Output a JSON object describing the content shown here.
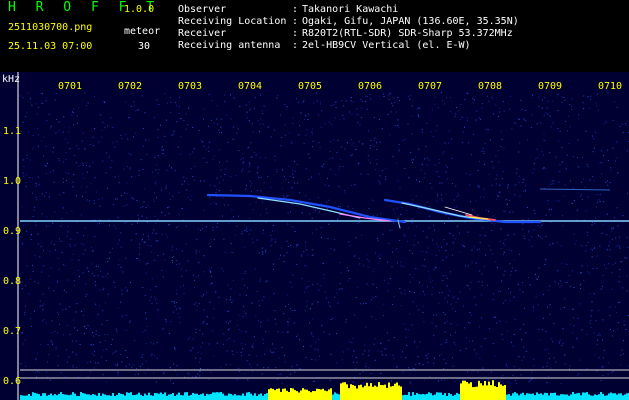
{
  "header": {
    "app_title": "H R O F F T",
    "version": "1.0.0",
    "filename": "2511030700.png",
    "category": "meteor",
    "datetime": "25.11.03 07:00",
    "count": "30"
  },
  "info": [
    {
      "label": "Observer",
      "value": "Takanori Kawachi"
    },
    {
      "label": "Receiving Location",
      "value": "Ogaki, Gifu, JAPAN (136.60E, 35.35N)"
    },
    {
      "label": "Receiver",
      "value": "R820T2(RTL-SDR) SDR-Sharp 53.372MHz"
    },
    {
      "label": "Receiving antenna",
      "value": "2el-HB9CV Vertical (el. E-W)"
    }
  ],
  "separator": ":",
  "axis": {
    "unit_label": "kHz",
    "x_ticks": [
      "0701",
      "0702",
      "0703",
      "0704",
      "0705",
      "0706",
      "0707",
      "0708",
      "0709",
      "0710"
    ],
    "y_ticks": [
      "1.1",
      "1.0",
      "0.9",
      "0.8",
      "0.7",
      "0.6"
    ]
  },
  "colors": {
    "background": "#000033",
    "carrier": "#7fd0ff",
    "reference_line": "#d8d8d8",
    "noise_floor": "#00e5ff",
    "noise_burst": "#ffff00",
    "tick_text": "#ffff00"
  }
}
